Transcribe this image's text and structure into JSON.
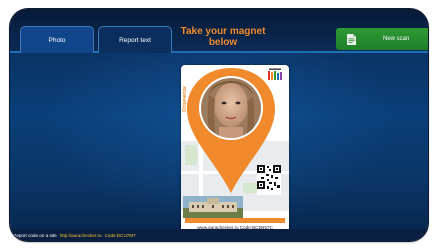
{
  "tabs": [
    {
      "label": "Photo",
      "active": true
    },
    {
      "label": "Report text",
      "active": false
    }
  ],
  "headline": {
    "line1": "Take your magnet",
    "line2": "below"
  },
  "new_scan": {
    "label": "New scan",
    "icon": "document-icon"
  },
  "card": {
    "side_text": "Отпечаток",
    "logo_icon": "brand-logo-icon",
    "url_text": "www.aurachecker.ru  Code:BC5N57C"
  },
  "footer": {
    "label": "Report code on a site",
    "link": "http://aurachecker.ru",
    "code": "Code:DCU7M7"
  },
  "colors": {
    "accent": "#f08a2c",
    "background": "#0a3f78",
    "new_scan_green": "#2f9a36",
    "footer_link": "#f4c430"
  }
}
